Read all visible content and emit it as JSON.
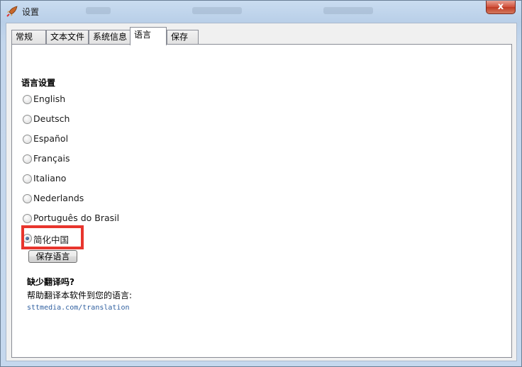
{
  "window": {
    "title": "设置",
    "close_glyph": "x"
  },
  "tabs": [
    {
      "label": "常规"
    },
    {
      "label": "文本文件"
    },
    {
      "label": "系统信息"
    },
    {
      "label": "语言",
      "active": true
    },
    {
      "label": "保存"
    }
  ],
  "language": {
    "section_title": "语言设置",
    "options": [
      {
        "label": "English",
        "checked": false
      },
      {
        "label": "Deutsch",
        "checked": false
      },
      {
        "label": "Español",
        "checked": false
      },
      {
        "label": "Français",
        "checked": false
      },
      {
        "label": "Italiano",
        "checked": false
      },
      {
        "label": "Nederlands",
        "checked": false
      },
      {
        "label": "Português do Brasil",
        "checked": false
      },
      {
        "label": "简化中国",
        "checked": true
      }
    ],
    "save_label": "保存语言"
  },
  "translation": {
    "title": "缺少翻译吗?",
    "help_text": "帮助翻译本软件到您的语言:",
    "link": "sttmedia.com/translation"
  },
  "colors": {
    "highlight": "#e8352d",
    "link": "#3060a0"
  }
}
